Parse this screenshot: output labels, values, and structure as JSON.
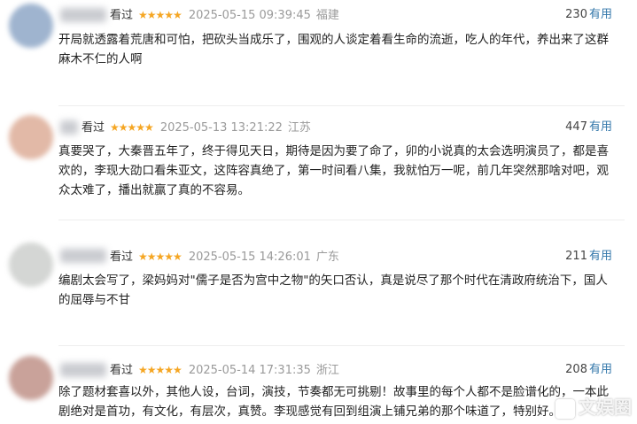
{
  "reviews": [
    {
      "status": "看过",
      "stars": "★★★★★",
      "time": "2025-05-15 09:39:45",
      "location": "福建",
      "votes": "230",
      "vote_label": "有用",
      "text": "开局就透露着荒唐和可怕，把砍头当成乐了，围观的人谈定着看生命的流逝，吃人的年代，养出来了这群麻木不仁的人啊",
      "avatar_color": "#9fb4cf"
    },
    {
      "status": "看过",
      "stars": "★★★★★",
      "time": "2025-05-13 13:21:22",
      "location": "江苏",
      "votes": "447",
      "vote_label": "有用",
      "text": "真要哭了，大秦晋五年了，终于得见天日，期待是因为要了命了，卯的小说真的太会选明演员了，都是喜欢的，李现大劭口看朱亚文，这阵容真绝了，第一时间看八集，我就怕万一呢，前几年突然那啥对吧，观众太难了，播出就赢了真的不容易。",
      "avatar_color": "#e2b9a7"
    },
    {
      "status": "看过",
      "stars": "★★★★★",
      "time": "2025-05-15 14:26:01",
      "location": "广东",
      "votes": "211",
      "vote_label": "有用",
      "text": "编剧太会写了，梁妈妈对\"儒子是否为宫中之物\"的矢口否认，真是说尽了那个时代在清政府统治下，国人的屈辱与不甘",
      "avatar_color": "#d4d6d4"
    },
    {
      "status": "看过",
      "stars": "★★★★★",
      "time": "2025-05-14 17:31:35",
      "location": "浙江",
      "votes": "208",
      "vote_label": "有用",
      "text": "除了题材套喜以外，其他人设，台词，演技，节奏都无可挑剔！故事里的每个人都不是脸谱化的，一本此剧绝对是首功，有文化，有层次，真赞。李现感觉有回到组演上铺兄弟的那个味道了，特别好。",
      "avatar_color": "#c9a29a"
    }
  ],
  "watermark": "文娱圈"
}
